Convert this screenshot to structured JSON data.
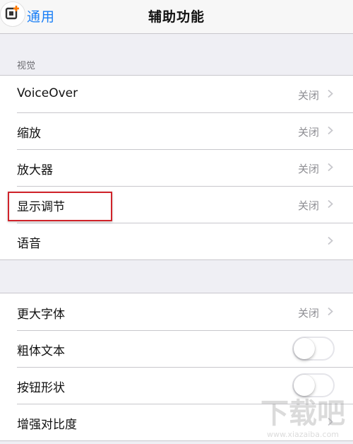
{
  "nav": {
    "back_label": "通用",
    "title": "辅助功能"
  },
  "vision": {
    "header": "视觉",
    "rows": [
      {
        "label": "VoiceOver",
        "value": "关闭"
      },
      {
        "label": "缩放",
        "value": "关闭"
      },
      {
        "label": "放大器",
        "value": "关闭"
      },
      {
        "label": "显示调节",
        "value": "关闭"
      },
      {
        "label": "语音",
        "value": ""
      }
    ]
  },
  "interaction": {
    "rows": [
      {
        "label": "更大字体",
        "value": "关闭"
      },
      {
        "label": "粗体文本",
        "toggle_on": false
      },
      {
        "label": "按钮形状",
        "toggle_on": false
      },
      {
        "label": "增强对比度",
        "value": ""
      }
    ]
  },
  "watermark": {
    "text": "下载吧",
    "url": "www.xiazaiba.com"
  },
  "colors": {
    "accent": "#1a7ff6",
    "highlight": "#d0232a",
    "background": "#efeff4"
  }
}
